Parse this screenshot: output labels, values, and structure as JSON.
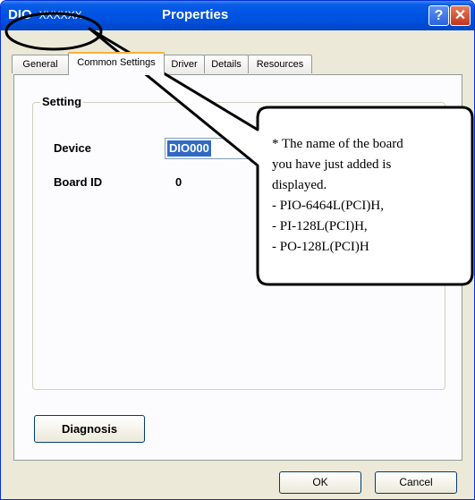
{
  "window": {
    "title_prefix": "DIO",
    "title_placeholder": "XXXXXX",
    "title": "Properties",
    "help_glyph": "?",
    "close_glyph": "✕"
  },
  "tabs": [
    {
      "label": "General"
    },
    {
      "label": "Common Settings",
      "active": true
    },
    {
      "label": "Driver"
    },
    {
      "label": "Details"
    },
    {
      "label": "Resources"
    }
  ],
  "setting_group": {
    "label": "Setting",
    "device_label": "Device",
    "device_value": "DIO000",
    "board_id_label": "Board ID",
    "board_id_value": "0"
  },
  "buttons": {
    "diagnosis": "Diagnosis",
    "ok": "OK",
    "cancel": "Cancel"
  },
  "callout": {
    "lines": [
      "* The name of the board",
      "  you have just added is",
      "  displayed.",
      " - PIO-6464L(PCI)H,",
      " - PI-128L(PCI)H,",
      " - PO-128L(PCI)H"
    ]
  }
}
